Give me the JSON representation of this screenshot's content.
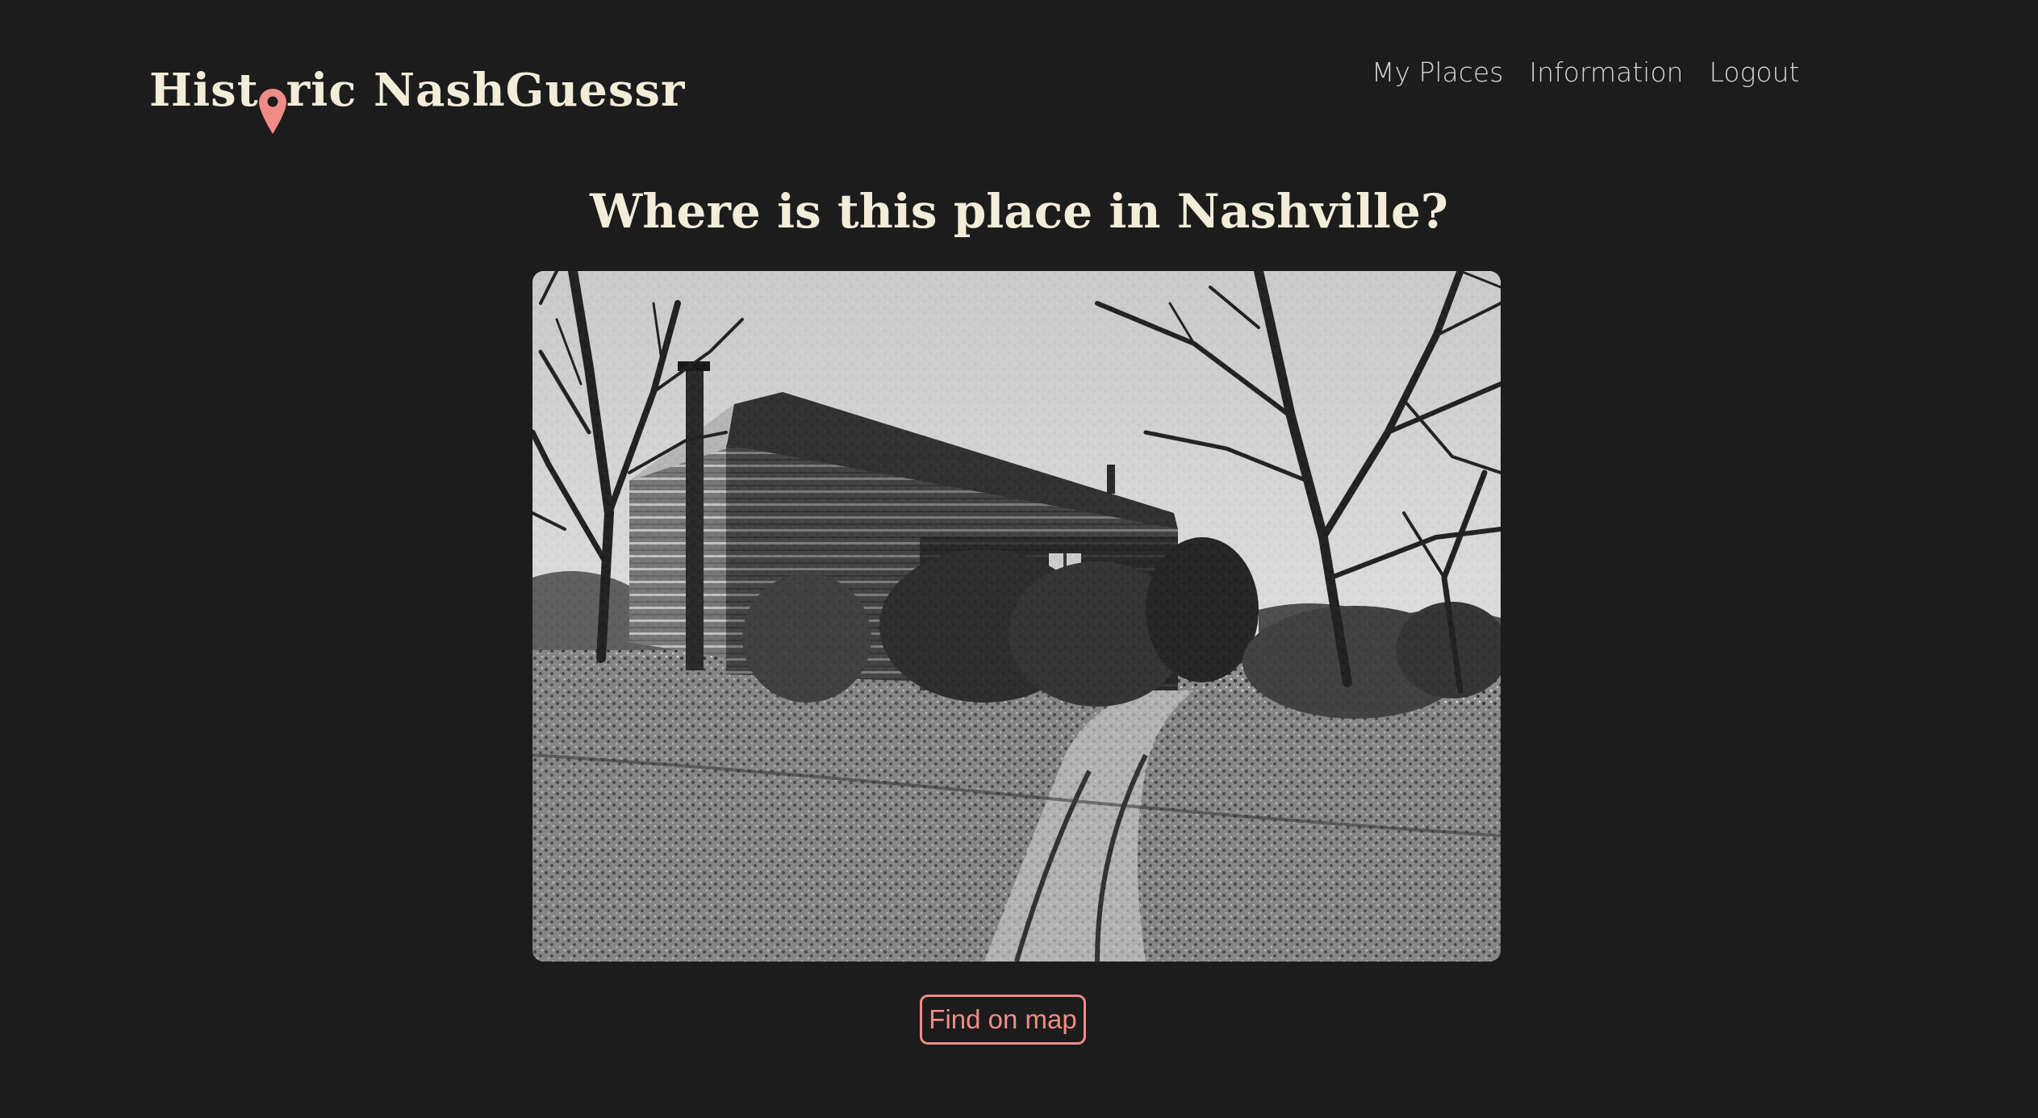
{
  "header": {
    "logo_before_pin": "Hist",
    "logo_after_pin": "ric NashGuessr",
    "nav": [
      {
        "label": "My Places"
      },
      {
        "label": "Information"
      },
      {
        "label": "Logout"
      }
    ]
  },
  "main": {
    "question": "Where is this place in Nashville?",
    "find_button_label": "Find on map"
  },
  "colors": {
    "background": "#1c1c1c",
    "text_cream": "#f3ecd9",
    "accent_coral": "#f08c88",
    "nav_text": "#d6d6d6"
  },
  "icons": {
    "logo_pin": "map-pin-icon"
  }
}
